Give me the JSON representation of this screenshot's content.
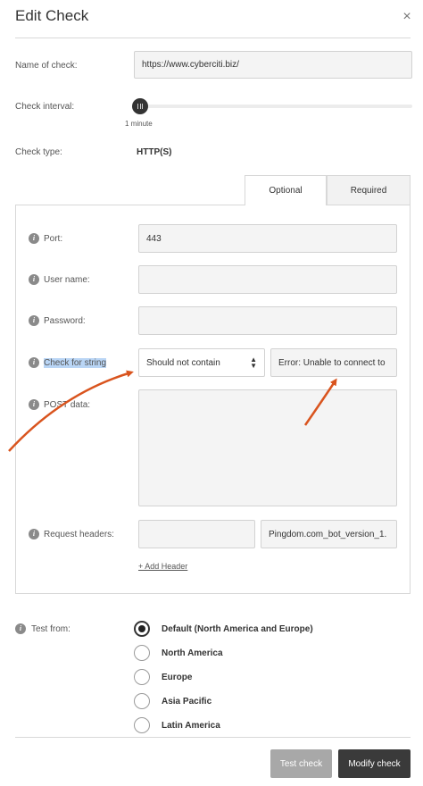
{
  "dialog": {
    "title": "Edit Check",
    "close_glyph": "×"
  },
  "form": {
    "name_label": "Name of check:",
    "name_value": "https://www.cyberciti.biz/",
    "interval_label": "Check interval:",
    "interval_value": "1 minute",
    "interval_level": 0,
    "type_label": "Check type:",
    "type_value": "HTTP(S)"
  },
  "tabs": [
    {
      "label": "Optional",
      "active": true
    },
    {
      "label": "Required",
      "active": false
    }
  ],
  "optional": {
    "port_label": "Port:",
    "port_value": "443",
    "username_label": "User name:",
    "username_value": "",
    "password_label": "Password:",
    "password_value": "",
    "check_string_label": "Check for string",
    "check_string_mode": "Should not contain",
    "check_string_value": "Error: Unable to connect to",
    "post_label": "POST data:",
    "post_value": "",
    "headers_label": "Request headers:",
    "header_name": "",
    "header_value": "Pingdom.com_bot_version_1.",
    "add_header": "+ Add Header"
  },
  "test_from": {
    "label": "Test from:",
    "options": [
      {
        "label": "Default (North America and Europe)",
        "checked": true
      },
      {
        "label": "North America",
        "checked": false
      },
      {
        "label": "Europe",
        "checked": false
      },
      {
        "label": "Asia Pacific",
        "checked": false
      },
      {
        "label": "Latin America",
        "checked": false
      }
    ]
  },
  "buttons": {
    "test": "Test check",
    "modify": "Modify check"
  },
  "icons": {
    "info": "info-icon",
    "close": "close-icon",
    "select_arrows": "select-arrows-icon"
  },
  "colors": {
    "annotation_arrow": "#d9541e",
    "text_highlight": "#b9d5f5",
    "primary_button": "#3a3a3a",
    "secondary_button": "#a8a8a8"
  }
}
